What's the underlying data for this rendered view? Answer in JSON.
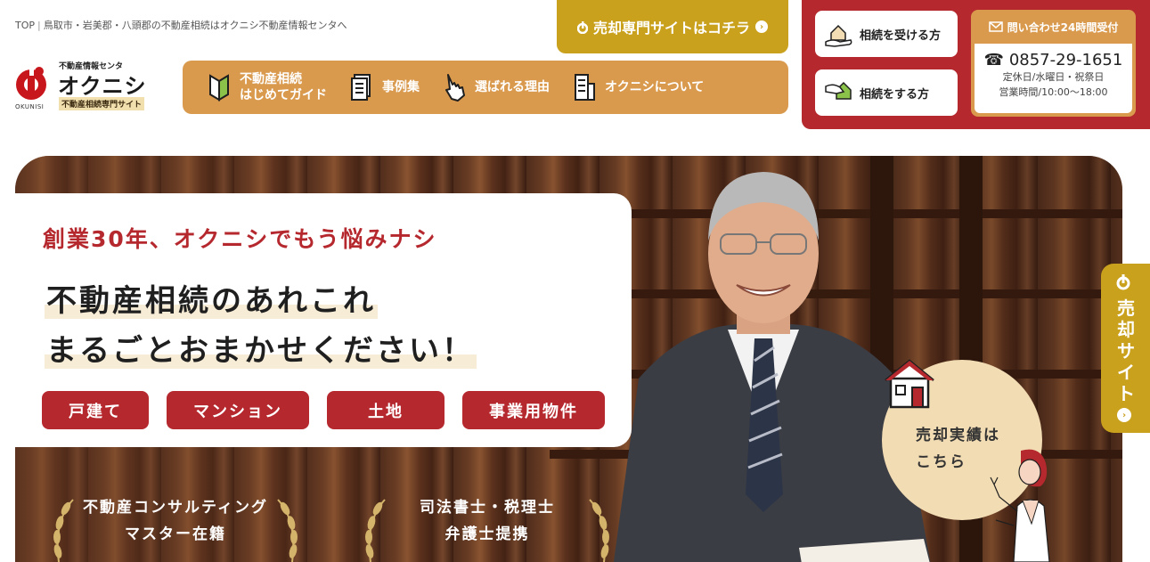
{
  "breadcrumb": {
    "top": "TOP",
    "current": "鳥取市・岩美郡・八頭郡の不動産相続はオクニシ不動産情報センタへ"
  },
  "logo": {
    "small": "不動産情報センタ",
    "name": "オクニシ",
    "tagline": "不動産相続専門サイト",
    "roman": "OKUNISI"
  },
  "sell_site_button": {
    "label": "売却専門サイトはコチラ"
  },
  "nav": {
    "items": [
      {
        "line1": "不動産相続",
        "line2": "はじめてガイド"
      },
      {
        "line1": "事例集",
        "line2": ""
      },
      {
        "line1": "選ばれる理由",
        "line2": ""
      },
      {
        "line1": "オクニシについて",
        "line2": ""
      }
    ]
  },
  "inherit": {
    "receive_label": "相続を受ける方",
    "give_label": "相続をする方"
  },
  "contact": {
    "title": "問い合わせ24時間受付",
    "tel": "0857-29-1651",
    "holidays": "定休日/水曜日・祝祭日",
    "hours": "営業時間/10:00〜18:00"
  },
  "hero": {
    "sub": "創業30年、オクニシでもう悩みナシ",
    "main_line1": "不動産相続のあれこれ",
    "main_line2": "まるごとおまかせください！",
    "tags": [
      "戸建て",
      "マンション",
      "土地",
      "事業用物件"
    ],
    "badges": [
      {
        "line1": "不動産コンサルティング",
        "line2": "マスター在籍"
      },
      {
        "line1": "司法書士・税理士",
        "line2": "弁護士提携"
      }
    ],
    "result": {
      "line1": "売却実績は",
      "line2": "こちら"
    }
  },
  "side_tab": {
    "label": "売却サイト"
  },
  "colors": {
    "red": "#b5282e",
    "orange": "#d99a4e",
    "gold": "#c9a11d",
    "beige": "#f2dcb3"
  }
}
